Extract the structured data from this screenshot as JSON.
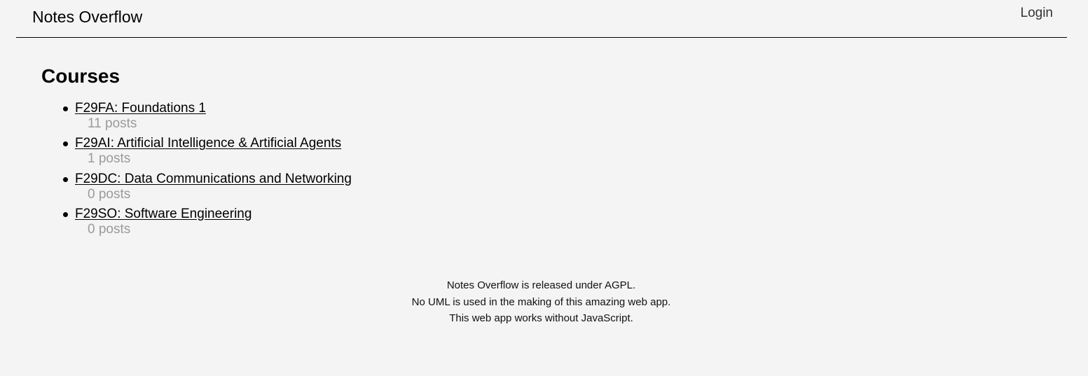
{
  "header": {
    "site_title": "Notes Overflow",
    "login_label": "Login"
  },
  "main": {
    "title": "Courses",
    "courses": [
      {
        "label": "F29FA: Foundations 1",
        "posts": "11 posts"
      },
      {
        "label": "F29AI: Artificial Intelligence & Artificial Agents",
        "posts": "1 posts"
      },
      {
        "label": "F29DC: Data Communications and Networking",
        "posts": "0 posts"
      },
      {
        "label": "F29SO: Software Engineering",
        "posts": "0 posts"
      }
    ]
  },
  "footer": {
    "lines": [
      "Notes Overflow is released under AGPL.",
      "No UML is used in the making of this amazing web app.",
      "This web app works without JavaScript."
    ]
  }
}
